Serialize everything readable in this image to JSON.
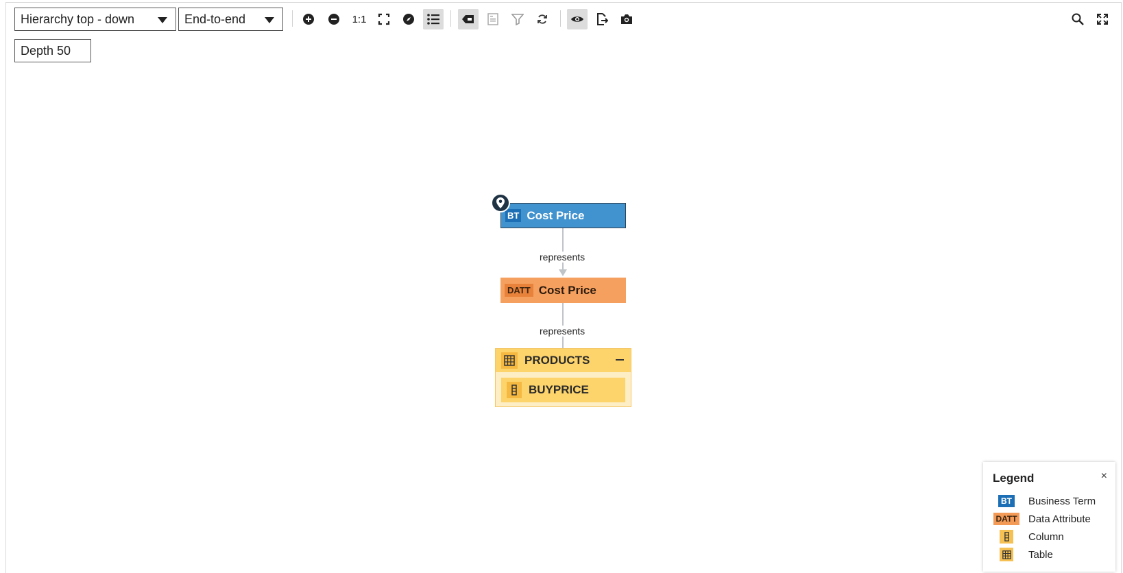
{
  "toolbar": {
    "layout_select": "Hierarchy top - down",
    "scope_select": "End-to-end",
    "depth": "Depth 50",
    "zoom_reset_label": "1:1"
  },
  "graph": {
    "nodes": [
      {
        "type_tag": "BT",
        "label": "Cost Price"
      },
      {
        "type_tag": "DATT",
        "label": "Cost Price"
      }
    ],
    "table": {
      "label": "PRODUCTS",
      "column": "BUYPRICE"
    },
    "edges": [
      {
        "label": "represents"
      },
      {
        "label": "represents"
      }
    ]
  },
  "legend": {
    "title": "Legend",
    "close": "×",
    "items": [
      {
        "tag": "BT",
        "label": "Business Term"
      },
      {
        "tag": "DATT",
        "label": "Data Attribute"
      },
      {
        "tag": "",
        "label": "Column"
      },
      {
        "tag": "",
        "label": "Table"
      }
    ]
  },
  "colors": {
    "business_term": "#4193cf",
    "data_attribute": "#f6a05f",
    "table": "#fdd46b",
    "edge": "#bfc4c8"
  }
}
